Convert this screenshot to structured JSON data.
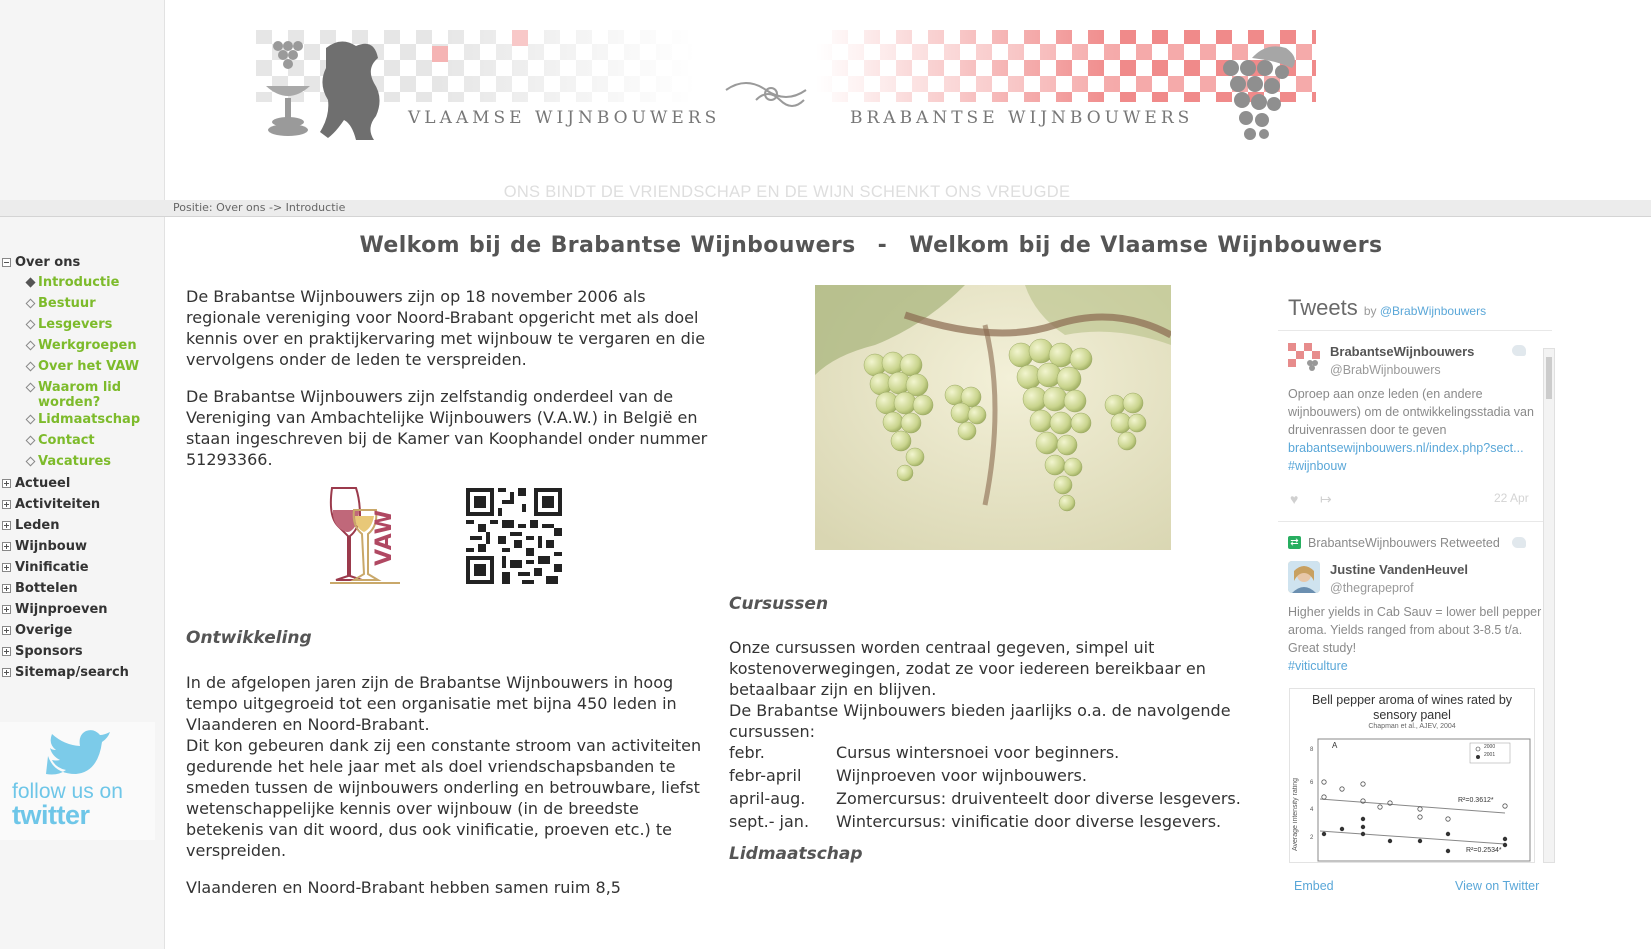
{
  "header": {
    "banner_left": "VLAAMSE WIJNBOUWERS",
    "banner_right": "BRABANTSE WIJNBOUWERS",
    "motto": "ONS BINDT DE VRIENDSCHAP EN DE WIJN SCHENKT ONS VREUGDE",
    "position": "Positie: Over ons -> Introductie"
  },
  "sidebar": {
    "sections": [
      {
        "label": "Over ons",
        "expanded": true,
        "items": [
          {
            "label": "Introductie",
            "active": true
          },
          {
            "label": "Bestuur"
          },
          {
            "label": "Lesgevers"
          },
          {
            "label": "Werkgroepen"
          },
          {
            "label": "Over het VAW"
          },
          {
            "label": "Waarom lid worden?"
          },
          {
            "label": "Lidmaatschap"
          },
          {
            "label": "Contact"
          },
          {
            "label": "Vacatures"
          }
        ]
      },
      {
        "label": "Actueel"
      },
      {
        "label": "Activiteiten"
      },
      {
        "label": "Leden"
      },
      {
        "label": "Wijnbouw"
      },
      {
        "label": "Vinificatie"
      },
      {
        "label": "Bottelen"
      },
      {
        "label": "Wijnproeven"
      },
      {
        "label": "Overige"
      },
      {
        "label": "Sponsors"
      },
      {
        "label": "Sitemap/search"
      }
    ],
    "twitter_follow": {
      "line1": "follow us on",
      "line2": "twitter"
    }
  },
  "main": {
    "heading_left": "Welkom bij de Brabantse Wijnbouwers",
    "heading_sep": "-",
    "heading_right": "Welkom bij de Vlaamse Wijnbouwers",
    "intro_p1": "De Brabantse Wijnbouwers zijn op 18 november 2006 als regionale vereniging voor Noord-Brabant opgericht met als doel kennis over en praktijkervaring met wijnbouw te vergaren en die vervolgens onder de leden te verspreiden.",
    "intro_p2": "De Brabantse Wijnbouwers zijn zelfstandig onderdeel van de Vereniging van Ambachtelijke Wijnbouwers (V.A.W.) in België en staan ingeschreven bij de Kamer van Koophandel onder nummer 51293366.",
    "vaw_logo_text": "VAW",
    "ontwikkeling_title": "Ontwikkeling",
    "ontwikkeling_p1": "In de afgelopen jaren zijn de Brabantse Wijnbouwers in hoog tempo uitgegroeid tot een organisatie met bijna 450 leden in Vlaanderen en Noord-Brabant.",
    "ontwikkeling_p2": "Dit kon gebeuren dank zij een constante stroom van activiteiten gedurende het hele jaar met als doel vriendschapsbanden te smeden tussen de wijnbouwers onderling en betrouwbare, liefst wetenschappelijke kennis over wijnbouw (in de breedste betekenis van dit woord, dus ook vinificatie, proeven etc.) te verspreiden.",
    "ontwikkeling_p3": "Vlaanderen en Noord-Brabant hebben samen ruim 8,5",
    "cursussen_title": "Cursussen",
    "cursussen_p1": "Onze cursussen worden centraal gegeven, simpel uit kostenoverwegingen, zodat ze voor iedereen bereikbaar en betaalbaar zijn en blijven.",
    "cursussen_p2": "De Brabantse Wijnbouwers bieden jaarlijks o.a. de navolgende cursussen:",
    "courses": [
      {
        "when": "febr.",
        "what": "Cursus wintersnoei voor beginners."
      },
      {
        "when": "febr-april",
        "what": "Wijnproeven voor wijnbouwers."
      },
      {
        "when": "april-aug.",
        "what": "Zomercursus: druiventeelt door diverse lesgevers."
      },
      {
        "when": "sept.- jan.",
        "what": "Wintercursus: vinificatie door diverse lesgevers."
      }
    ],
    "lidmaatschap_title": "Lidmaatschap"
  },
  "tweets": {
    "title": "Tweets",
    "by": "by",
    "by_handle": "@BrabWijnbouwers",
    "items": [
      {
        "name": "BrabantseWijnbouwers",
        "handle": "@BrabWijnbouwers",
        "text": "Oproep aan onze leden (en andere wijnbouwers) om de ontwikkelingsstadia van druivenrassen door te geven",
        "link": "brabantsewijnbouwers.nl/index.php?sect...",
        "hashtag": "#wijnbouw",
        "date": "22 Apr"
      },
      {
        "retweet_label": "BrabantseWijnbouwers Retweeted",
        "name": "Justine VandenHeuvel",
        "handle": "@thegrapeprof",
        "text": "Higher yields in Cab Sauv = lower bell pepper aroma.  Yields ranged from about 3-8.5 t/a. Great study!",
        "hashtag": "#viticulture"
      }
    ],
    "chart": {
      "title": "Bell pepper aroma of wines rated by sensory panel",
      "citation": "Chapman et al., AJEV, 2004",
      "panel": "A",
      "ylabel": "Average intensity rating",
      "legend": [
        "2000",
        "2001"
      ],
      "r2_a": "R²=0.3612*",
      "r2_b": "R²=0.2534*"
    },
    "embed": "Embed",
    "view": "View on Twitter"
  },
  "colors": {
    "nav_link": "#7dbb2b",
    "twitter_blue": "#5aa7d8",
    "checker_red": "#e84a4a"
  }
}
